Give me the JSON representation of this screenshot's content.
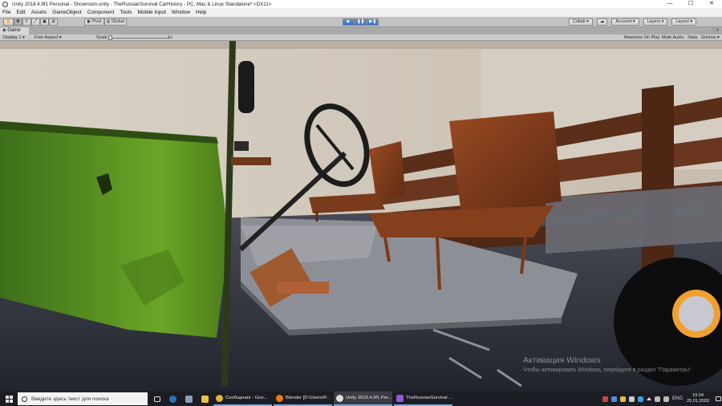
{
  "window": {
    "title": "Unity 2018.4.9f1 Personal - Showroom.unity - TheRussianSurvival CarHistory - PC, Mac & Linux Standalone* <DX11>",
    "controls": [
      "—",
      "☐",
      "✕"
    ]
  },
  "menu": [
    "File",
    "Edit",
    "Assets",
    "GameObject",
    "Component",
    "Tools",
    "Mobile Input",
    "Window",
    "Help"
  ],
  "toolbar": {
    "pivot_label": "Pivot",
    "global_label": "Global",
    "collab_label": "Collab ▾",
    "account_label": "Account ▾",
    "layers_label": "Layers ▾",
    "layout_label": "Layout ▾",
    "play_icon": "play-icon",
    "pause_icon": "pause-icon",
    "step_icon": "step-icon",
    "play_active": true
  },
  "game_view": {
    "tab_label": "Game",
    "display": "Display 1",
    "aspect": "Free Aspect",
    "scale_label": "Scale",
    "scale_value": "1x",
    "scale_level": 0.02,
    "maximize_on_play": "Maximize On Play",
    "mute_audio": "Mute Audio",
    "stats": "Stats",
    "gizmos": "Gizmos ▾"
  },
  "watermark": {
    "line1": "Активация Windows",
    "line2": "Чтобы активировать Windows, перейдите в раздел \"Параметры\"."
  },
  "taskbar": {
    "search_placeholder": "Введите здесь текст для поиска",
    "apps": [
      {
        "label": "Сообщения - Goo...",
        "color": "#e0b43a"
      },
      {
        "label": "Blender [D:\\Users\\P...",
        "color": "#e87d0d"
      },
      {
        "label": "Unity 2018.4.9f1 Per...",
        "color": "#dddddd"
      },
      {
        "label": "TheRussianSurvival ...",
        "color": "#8b5bd6"
      }
    ],
    "lang": "ENG",
    "time": "19:24",
    "date": "25.01.2020"
  }
}
